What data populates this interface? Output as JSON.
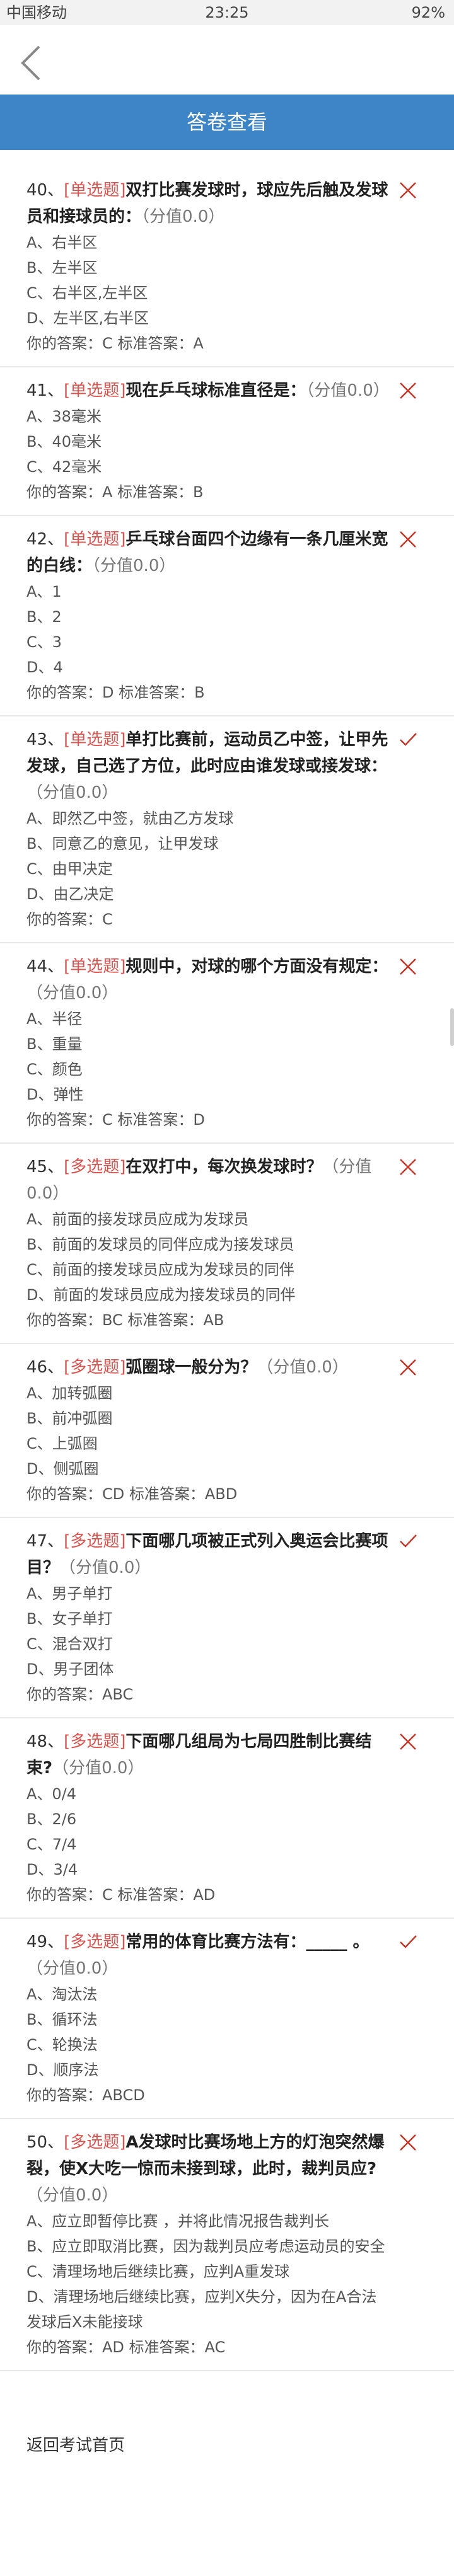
{
  "status_bar": {
    "carrier": "中国移动",
    "time": "23:25",
    "battery": "92%"
  },
  "nav": {
    "back_icon": "chevron-left-icon"
  },
  "header": {
    "title": "答卷查看"
  },
  "questions": [
    {
      "num": "40、",
      "type": "[单选题]",
      "stem": "双打比赛发球时，球应先后触及发球员和接球员的：",
      "score": "（分值0.0）",
      "options": [
        "A、右半区",
        "B、左半区",
        "C、右半区,左半区",
        "D、左半区,右半区"
      ],
      "answer": "你的答案：C 标准答案：A",
      "result": "wrong"
    },
    {
      "num": "41、",
      "type": "[单选题]",
      "stem": "现在乒乓球标准直径是：",
      "score": "（分值0.0）",
      "options": [
        "A、38毫米",
        "B、40毫米",
        "C、42毫米"
      ],
      "answer": "你的答案：A 标准答案：B",
      "result": "wrong"
    },
    {
      "num": "42、",
      "type": "[单选题]",
      "stem": "乒乓球台面四个边缘有一条几厘米宽的白线：",
      "score": "（分值0.0）",
      "options": [
        "A、1",
        "B、2",
        "C、3",
        "D、4"
      ],
      "answer": "你的答案：D 标准答案：B",
      "result": "wrong"
    },
    {
      "num": "43、",
      "type": "[单选题]",
      "stem": "单打比赛前，运动员乙中签，让甲先发球，自己选了方位，此时应由谁发球或接发球：",
      "score": "（分值0.0）",
      "options": [
        "A、即然乙中签，就由乙方发球",
        "B、同意乙的意见，让甲发球",
        "C、由甲决定",
        "D、由乙决定"
      ],
      "answer": "你的答案：C",
      "result": "right"
    },
    {
      "num": "44、",
      "type": "[单选题]",
      "stem": "规则中，对球的哪个方面没有规定：",
      "score": "（分值0.0）",
      "options": [
        "A、半径",
        "B、重量",
        "C、颜色",
        "D、弹性"
      ],
      "answer": "你的答案：C 标准答案：D",
      "result": "wrong"
    },
    {
      "num": "45、",
      "type": "[多选题]",
      "stem": "在双打中，每次换发球时？",
      "score": "（分值0.0）",
      "options": [
        "A、前面的接发球员应成为发球员",
        "B、前面的发球员的同伴应成为接发球员",
        "C、前面的接发球员应成为发球员的同伴",
        "D、前面的发球员应成为接发球员的同伴"
      ],
      "answer": "你的答案：BC 标准答案：AB",
      "result": "wrong"
    },
    {
      "num": "46、",
      "type": "[多选题]",
      "stem": "弧圈球一般分为？",
      "score": "（分值0.0）",
      "options": [
        "A、加转弧圈",
        "B、前冲弧圈",
        "C、上弧圈",
        "D、侧弧圈"
      ],
      "answer": "你的答案：CD 标准答案：ABD",
      "result": "wrong"
    },
    {
      "num": "47、",
      "type": "[多选题]",
      "stem": "下面哪几项被正式列入奥运会比赛项目？",
      "score": "（分值0.0）",
      "options": [
        "A、男子单打",
        "B、女子单打",
        "C、混合双打",
        "D、男子团体"
      ],
      "answer": "你的答案：ABC",
      "result": "right"
    },
    {
      "num": "48、",
      "type": "[多选题]",
      "stem": "下面哪几组局为七局四胜制比赛结束?",
      "score": "（分值0.0）",
      "options": [
        "A、0/4",
        "B、2/6",
        "C、7/4",
        "D、3/4"
      ],
      "answer": "你的答案：C 标准答案：AD",
      "result": "wrong"
    },
    {
      "num": "49、",
      "type": "[多选题]",
      "stem": "常用的体育比赛方法有：_____ 。",
      "score": "（分值0.0）",
      "options": [
        "A、淘汰法",
        "B、循环法",
        "C、轮换法",
        "D、顺序法"
      ],
      "answer": "你的答案：ABCD",
      "result": "right"
    },
    {
      "num": "50、",
      "type": "[多选题]",
      "stem": "A发球时比赛场地上方的灯泡突然爆裂，使X大吃一惊而未接到球，此时，裁判员应?",
      "score": "（分值0.0）",
      "options": [
        "A、应立即暂停比赛 ，并将此情况报告裁判长",
        "B、应立即取消比赛，因为裁判员应考虑运动员的安全",
        "C、清理场地后继续比赛，应判A重发球",
        "D、清理场地后继续比赛，应判X失分，因为在A合法发球后X未能接球"
      ],
      "answer": "你的答案：AD 标准答案：AC",
      "result": "wrong"
    }
  ],
  "footer": {
    "link": "返回考试首页"
  },
  "colors": {
    "header_bg": "#3d85c6",
    "type_red": "#d9534f",
    "wrong_mark": "#c0392b",
    "right_mark": "#c0392b"
  }
}
